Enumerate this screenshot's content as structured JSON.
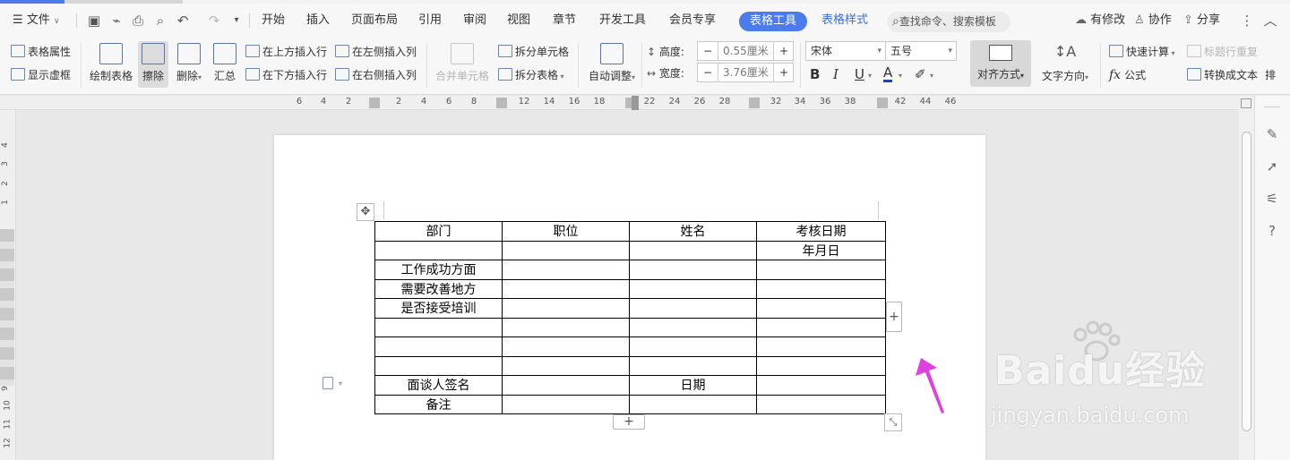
{
  "menu": {
    "file": "文件",
    "tabs": [
      "开始",
      "插入",
      "页面布局",
      "引用",
      "审阅",
      "视图",
      "章节",
      "开发工具",
      "会员专享"
    ],
    "active_tab": "表格工具",
    "table_style_tab": "表格样式",
    "search_placeholder": "查找命令、搜索模板",
    "modified": "有修改",
    "collab": "协作",
    "share": "分享"
  },
  "ribbon": {
    "table_props": "表格属性",
    "show_gridlines": "显示虚框",
    "draw_table": "绘制表格",
    "erase": "擦除",
    "delete": "删除",
    "summary": "汇总",
    "insert_above": "在上方插入行",
    "insert_below": "在下方插入行",
    "insert_left": "在左侧插入列",
    "insert_right": "在右侧插入列",
    "merge_cells": "合并单元格",
    "split_cells": "拆分单元格",
    "split_table": "拆分表格",
    "auto_fit": "自动调整",
    "height_label": "高度:",
    "height_value": "0.55厘米",
    "width_label": "宽度:",
    "width_value": "3.76厘米",
    "font_name": "宋体",
    "font_size": "五号",
    "bold": "B",
    "italic": "I",
    "underline": "U",
    "font_color": "A",
    "alignment": "对齐方式",
    "text_direction": "文字方向",
    "quick_calc": "快速计算",
    "formula": "公式",
    "repeat_header": "标题行重复",
    "convert_text": "转换成文本",
    "more": "排"
  },
  "ruler": {
    "h_numbers": [
      "6",
      "4",
      "2",
      "2",
      "4",
      "6",
      "8",
      "12",
      "14",
      "16",
      "18",
      "22",
      "24",
      "26",
      "28",
      "32",
      "34",
      "36",
      "38",
      "42",
      "44",
      "46"
    ],
    "v_numbers": [
      "4",
      "3",
      "2",
      "1",
      "9",
      "10",
      "11",
      "12"
    ]
  },
  "table": {
    "rows": [
      [
        "部门",
        "职位",
        "姓名",
        "考核日期"
      ],
      [
        "",
        "",
        "",
        "年月日"
      ],
      [
        "工作成功方面",
        "",
        "",
        ""
      ],
      [
        "需要改善地方",
        "",
        "",
        ""
      ],
      [
        "是否接受培训",
        "",
        "",
        ""
      ],
      [
        "",
        "",
        "",
        ""
      ],
      [
        "",
        "",
        "",
        ""
      ],
      [
        "",
        "",
        "",
        ""
      ],
      [
        "面谈人签名",
        "",
        "日期",
        ""
      ],
      [
        "备注",
        "",
        "",
        ""
      ]
    ]
  },
  "watermark": {
    "brand": "Baidu经验",
    "url": "jingyan.baidu.com"
  },
  "colors": {
    "accent": "#4b7bec",
    "arrow": "#e040e0"
  }
}
